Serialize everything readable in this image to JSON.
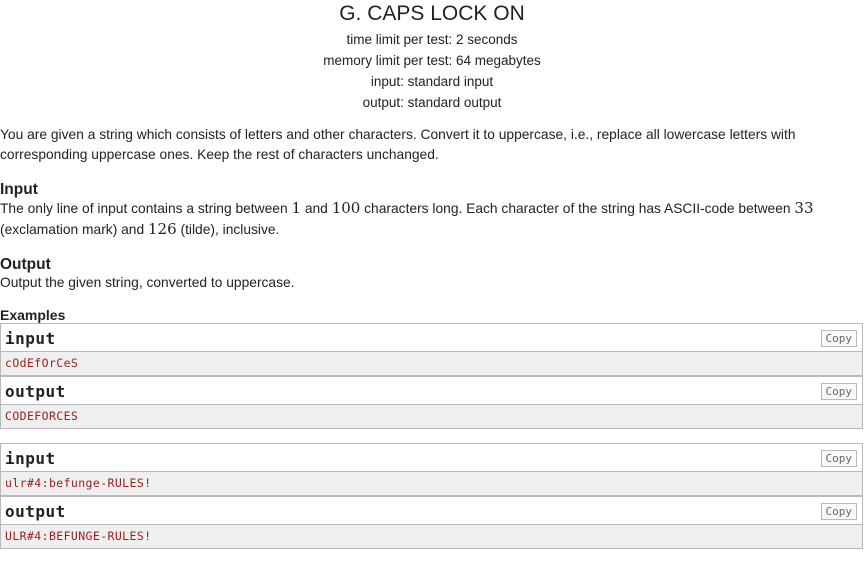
{
  "problem": {
    "title": "G. CAPS LOCK ON",
    "time_limit": "time limit per test: 2 seconds",
    "memory_limit": "memory limit per test: 64 megabytes",
    "input_file": "input: standard input",
    "output_file": "output: standard output"
  },
  "legend": {
    "text": "You are given a string which consists of letters and other characters. Convert it to uppercase, i.e., replace all lowercase letters with corresponding uppercase ones. Keep the rest of characters unchanged."
  },
  "input_section": {
    "title": "Input",
    "part1": "The only line of input contains a string between ",
    "num1": "1",
    "part2": " and ",
    "num2": "100",
    "part3": " characters long. Each character of the string has ASCII-code between ",
    "num3": "33",
    "part4": " (exclamation mark) and ",
    "num4": "126",
    "part5": " (tilde), inclusive."
  },
  "output_section": {
    "title": "Output",
    "text": "Output the given string, converted to uppercase."
  },
  "examples": {
    "title": "Examples",
    "copy_label": "Copy",
    "input_label": "input",
    "output_label": "output",
    "items": [
      {
        "input": "cOdEfOrCeS",
        "output": "CODEFORCES"
      },
      {
        "input": "ulr#4:befunge-RULES!",
        "output": "ULR#4:BEFUNGE-RULES!"
      }
    ]
  }
}
